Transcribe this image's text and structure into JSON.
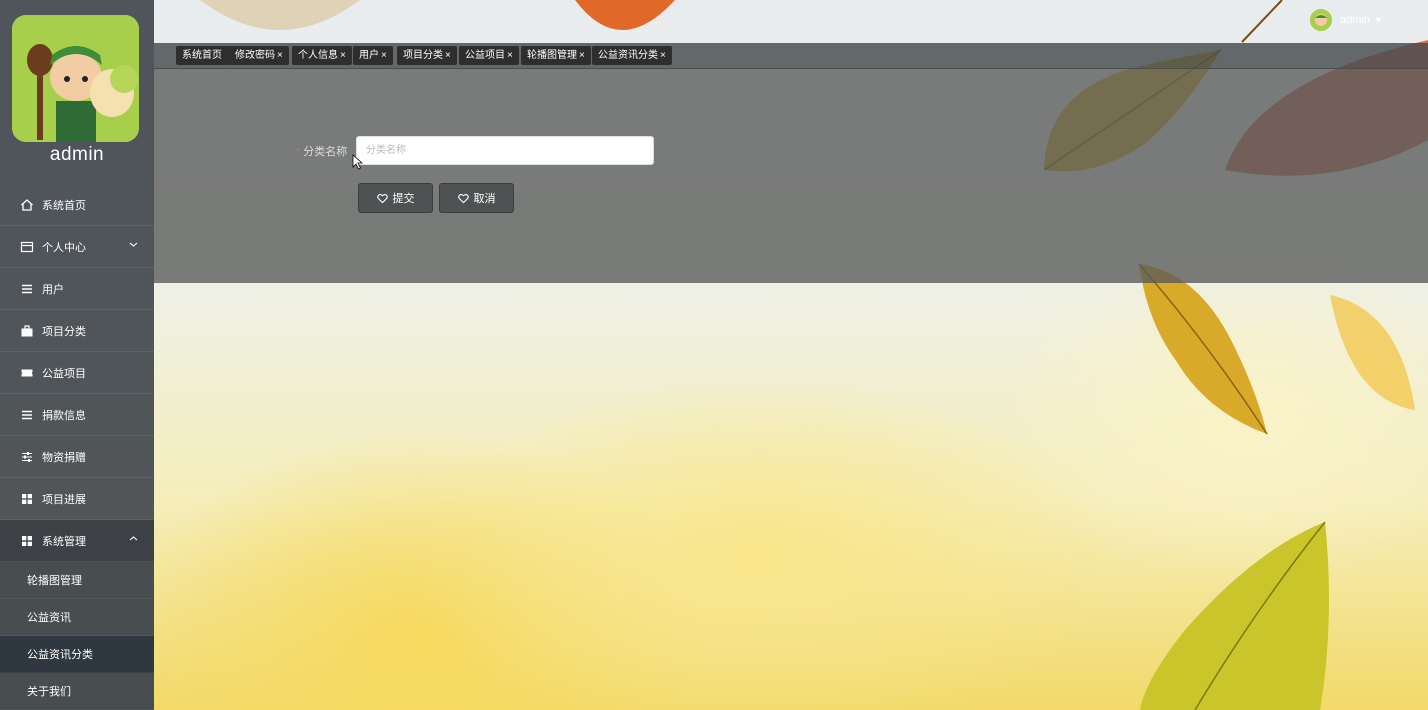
{
  "sidebar": {
    "user_name": "admin",
    "items": [
      {
        "label": "系统首页",
        "icon": "home-icon"
      },
      {
        "label": "个人中心",
        "icon": "card-icon",
        "expand": "chevron-down-icon"
      },
      {
        "label": "用户",
        "icon": "list-icon"
      },
      {
        "label": "项目分类",
        "icon": "briefcase-icon"
      },
      {
        "label": "公益项目",
        "icon": "ticket-icon"
      },
      {
        "label": "捐款信息",
        "icon": "list-icon"
      },
      {
        "label": "物资捐赠",
        "icon": "sliders-icon"
      },
      {
        "label": "项目进展",
        "icon": "grid-icon"
      },
      {
        "label": "系统管理",
        "icon": "grid-icon",
        "expand": "chevron-up-icon"
      }
    ],
    "sub_items": [
      {
        "label": "轮播图管理"
      },
      {
        "label": "公益资讯"
      },
      {
        "label": "公益资讯分类",
        "active": true
      },
      {
        "label": "关于我们"
      }
    ]
  },
  "header": {
    "user": "admin",
    "caret": "▼"
  },
  "tags": [
    {
      "label": "系统首页",
      "close": ""
    },
    {
      "label": "修改密码",
      "close": "×"
    },
    {
      "label": "个人信息",
      "close": "×"
    },
    {
      "label": "用户",
      "close": "×"
    },
    {
      "label": "项目分类",
      "close": "×"
    },
    {
      "label": "公益项目",
      "close": "×"
    },
    {
      "label": "轮播图管理",
      "close": "×"
    },
    {
      "label": "公益资讯分类",
      "close": "×"
    }
  ],
  "form": {
    "required_mark": "*",
    "field_label": "分类名称",
    "field_value": "",
    "field_placeholder": "分类名称",
    "submit_label": "提交",
    "cancel_label": "取消"
  },
  "colors": {
    "sidebar": "#42484e",
    "active_sub": "#2f3740",
    "required": "#e36a6a"
  }
}
